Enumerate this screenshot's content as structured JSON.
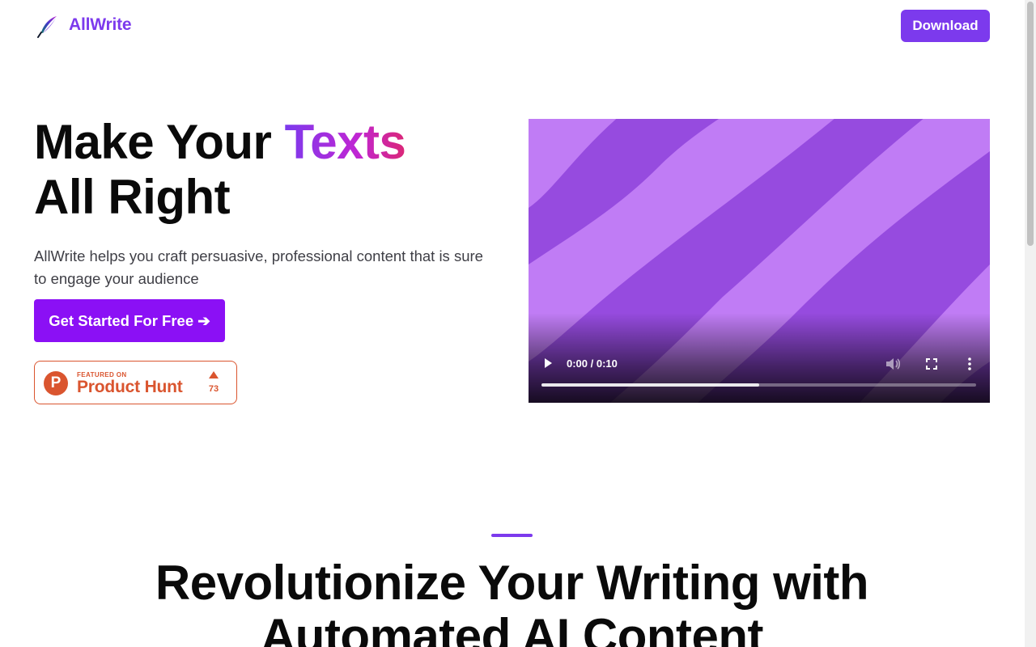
{
  "header": {
    "brand_name": "AllWrite",
    "logo_icon": "quill-feather-icon",
    "download_label": "Download"
  },
  "hero": {
    "title_line1_prefix": "Make Your ",
    "title_line1_highlight": "Texts",
    "title_line2": "All Right",
    "subtitle": "AllWrite helps you craft persuasive, professional content that is sure to engage your audience",
    "cta_label": "Get Started For Free ➔"
  },
  "product_hunt": {
    "small_label": "FEATURED ON",
    "big_label": "Product Hunt",
    "logo_letter": "P",
    "upvote_icon": "upvote-triangle-icon",
    "count": "73"
  },
  "video": {
    "time_label": "0:00 / 0:10",
    "progress_buffered": 0.5,
    "icons": {
      "play": "play-icon",
      "volume": "volume-icon",
      "fullscreen": "fullscreen-icon",
      "more": "more-vertical-icon"
    }
  },
  "section2": {
    "title": "Revolutionize Your Writing with Automated AI Content"
  },
  "colors": {
    "brand_purple": "#7c3aed",
    "cta_purple": "#8b10f5",
    "product_hunt_orange": "#da552f",
    "video_dark_stripe": "#964bdf",
    "video_light_stripe": "#c07cf5"
  }
}
